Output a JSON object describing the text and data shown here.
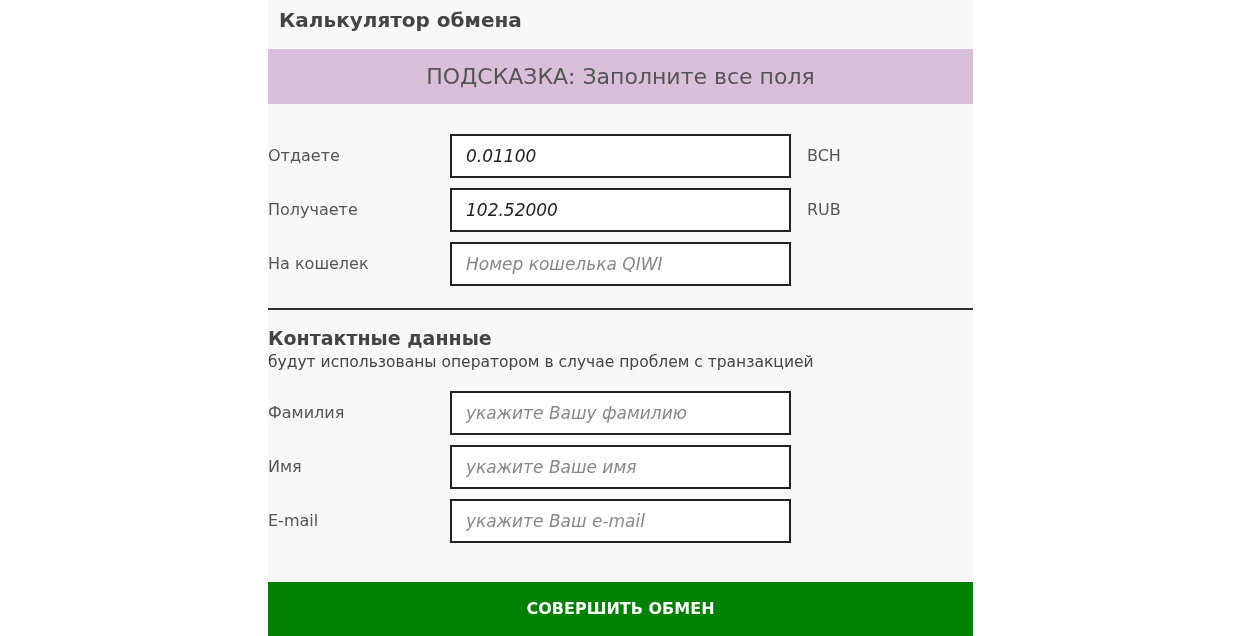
{
  "title": "Калькулятор обмена",
  "hint": "ПОДСКАЗКА: Заполните все поля",
  "exchange_fields": [
    {
      "label": "Отдаете",
      "value": "0.01100",
      "unit": "BCH"
    },
    {
      "label": "Получаете",
      "value": "102.52000",
      "unit": "RUB"
    },
    {
      "label": "На кошелек",
      "placeholder": "Номер кошелька QIWI"
    }
  ],
  "contact": {
    "heading": "Контактные данные",
    "subtitle": "будут использованы оператором в случае проблем с транзакцией",
    "fields": [
      {
        "label": "Фамилия",
        "placeholder": "укажите Вашу фамилию"
      },
      {
        "label": "Имя",
        "placeholder": "укажите Ваше имя"
      },
      {
        "label": "E-mail",
        "placeholder": "укажите Ваш e-mail"
      }
    ]
  },
  "submit_button": "СОВЕРШИТЬ ОБМЕН"
}
